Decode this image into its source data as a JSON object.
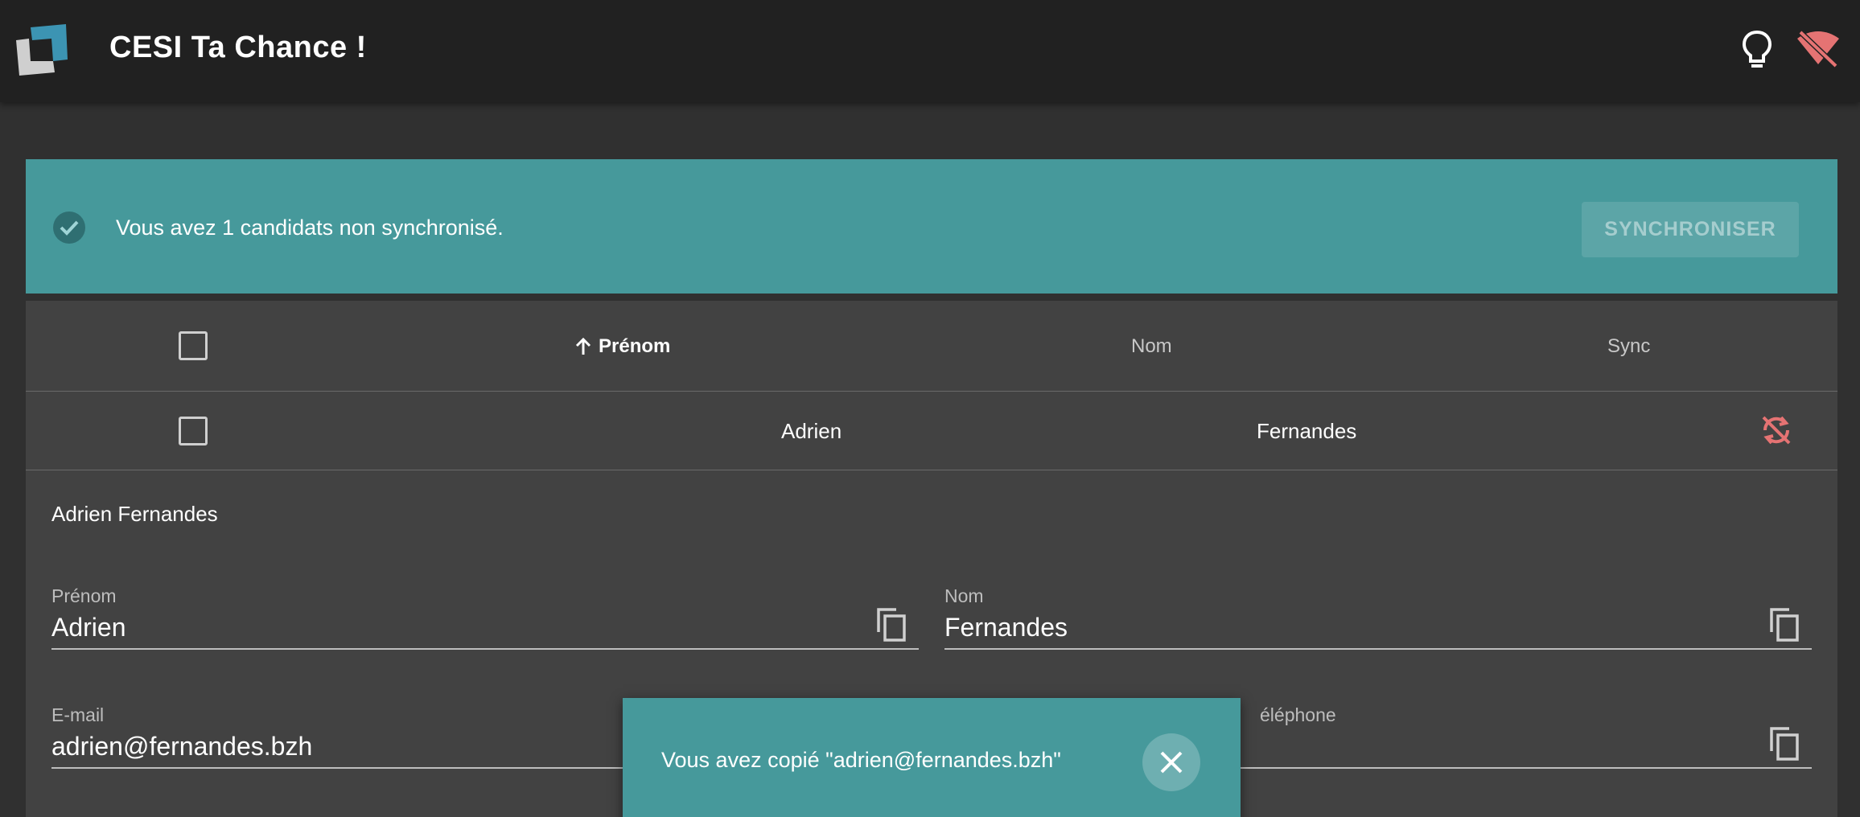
{
  "app": {
    "title": "CESI Ta Chance !"
  },
  "banner": {
    "message": "Vous avez 1 candidats non synchronisé.",
    "sync_label": "SYNCHRONISER"
  },
  "table": {
    "headers": {
      "first": "Prénom",
      "last": "Nom",
      "sync": "Sync"
    },
    "sort": "ascending",
    "rows": [
      {
        "first": "Adrien",
        "last": "Fernandes",
        "synced": false
      }
    ]
  },
  "detail": {
    "full_name": "Adrien Fernandes",
    "fields": {
      "prenom": {
        "label": "Prénom",
        "value": "Adrien"
      },
      "nom": {
        "label": "Nom",
        "value": "Fernandes"
      },
      "email": {
        "label": "E-mail",
        "value": "adrien@fernandes.bzh"
      },
      "phone": {
        "label": "éléphone",
        "value": ""
      }
    }
  },
  "snackbar": {
    "message": "Vous avez copié \"adrien@fernandes.bzh\""
  },
  "colors": {
    "accent": "#46999b",
    "appbar": "#212121",
    "background": "#303030",
    "surface": "#424242",
    "error": "#e57373"
  },
  "icons": [
    "logo",
    "lightbulb-icon",
    "wifi-off-icon",
    "check-circle-icon",
    "arrow-up-icon",
    "sync-off-icon",
    "copy-icon",
    "close-icon"
  ]
}
